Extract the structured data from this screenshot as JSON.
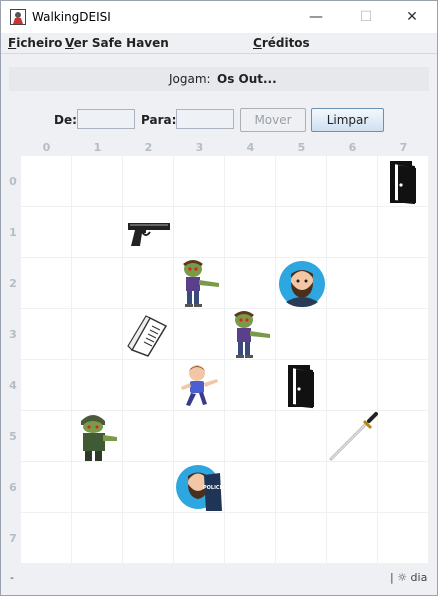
{
  "window": {
    "title": "WalkingDEISI",
    "minimize": "—",
    "maximize": "☐",
    "close": "✕"
  },
  "menu": {
    "file": {
      "first": "F",
      "rest": "icheiro"
    },
    "view": {
      "first": "V",
      "rest": "er Safe Haven"
    },
    "credits": {
      "first": "C",
      "rest": "réditos"
    }
  },
  "players": {
    "label": "Jogam:",
    "value": "Os Out..."
  },
  "controls": {
    "from_label": "De:",
    "to_label": "Para:",
    "from_value": "",
    "to_value": "",
    "move_button": "Mover",
    "clear_button": "Limpar"
  },
  "board": {
    "columns": [
      "0",
      "1",
      "2",
      "3",
      "4",
      "5",
      "6",
      "7"
    ],
    "rows": [
      "0",
      "1",
      "2",
      "3",
      "4",
      "5",
      "6",
      "7"
    ],
    "pieces": [
      {
        "type": "door-icon",
        "col": 7,
        "row": 0
      },
      {
        "type": "pistol-icon",
        "col": 2,
        "row": 1
      },
      {
        "type": "zombie-icon",
        "col": 3,
        "row": 2
      },
      {
        "type": "bearded-man-avatar",
        "col": 5,
        "row": 2
      },
      {
        "type": "newspaper-icon",
        "col": 2,
        "row": 3
      },
      {
        "type": "zombie-icon",
        "col": 4,
        "row": 3
      },
      {
        "type": "child-icon",
        "col": 3,
        "row": 4
      },
      {
        "type": "door-icon",
        "col": 5,
        "row": 4
      },
      {
        "type": "soldier-zombie-icon",
        "col": 1,
        "row": 5
      },
      {
        "type": "katana-icon",
        "col": 6,
        "row": 5
      },
      {
        "type": "police-human-icon",
        "col": 3,
        "row": 6
      }
    ],
    "police_text": "POLICE"
  },
  "status": {
    "left": "-",
    "right": "| ☼ dia"
  }
}
